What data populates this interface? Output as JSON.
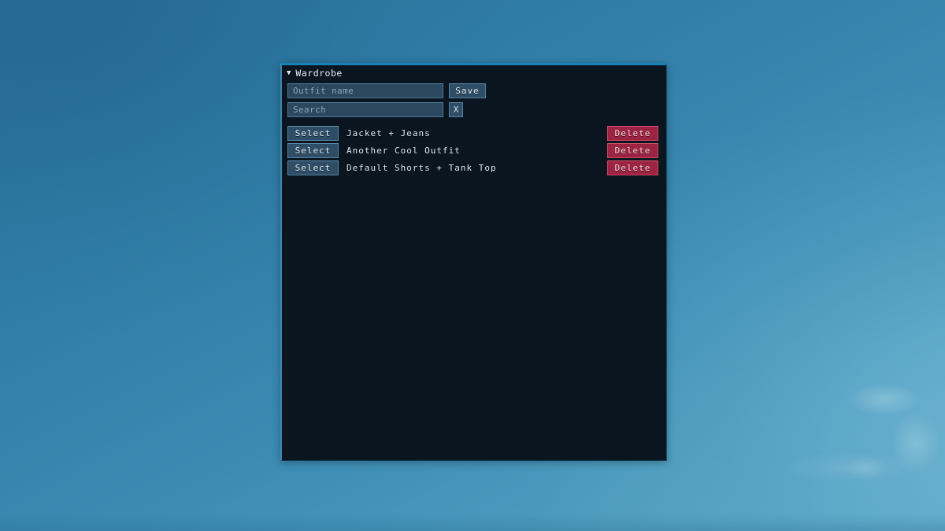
{
  "panel": {
    "collapse_icon": "▼",
    "title": "Wardrobe",
    "accent_border": "#1a81b8",
    "background": "#0a151f"
  },
  "form": {
    "outfit_name_input": {
      "value": "",
      "placeholder": "Outfit name"
    },
    "save_label": "Save",
    "search_input": {
      "value": "",
      "placeholder": "Search"
    },
    "clear_label": "X"
  },
  "outfits": [
    {
      "select_label": "Select",
      "name": "Jacket + Jeans",
      "delete_label": "Delete"
    },
    {
      "select_label": "Select",
      "name": "Another Cool Outfit",
      "delete_label": "Delete"
    },
    {
      "select_label": "Select",
      "name": "Default Shorts + Tank Top",
      "delete_label": "Delete"
    }
  ],
  "theme": {
    "desktop_background": "#2f7ca6",
    "input_fill": "#2b4860",
    "button_fill": "#2e4d66",
    "delete_fill": "#9c2341",
    "text_color": "#dfe9f1"
  }
}
